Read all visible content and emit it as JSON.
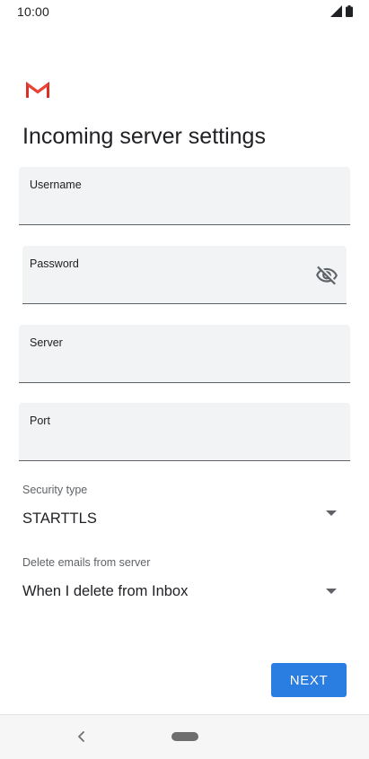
{
  "status_bar": {
    "time": "10:00",
    "icons": [
      "signal-icon",
      "battery-icon"
    ]
  },
  "app": {
    "logo": "gmail-logo"
  },
  "page": {
    "title": "Incoming server settings"
  },
  "fields": {
    "username": {
      "label": "Username",
      "value": ""
    },
    "password": {
      "label": "Password",
      "value": "",
      "toggle_icon": "visibility-off-icon"
    },
    "server": {
      "label": "Server",
      "value": ""
    },
    "port": {
      "label": "Port",
      "value": ""
    }
  },
  "security_type": {
    "label": "Security type",
    "value": "STARTTLS",
    "icon": "dropdown-arrow-icon"
  },
  "delete_emails": {
    "label": "Delete emails from server",
    "value": "When I delete from Inbox",
    "icon": "dropdown-arrow-icon"
  },
  "actions": {
    "next_label": "NEXT"
  },
  "colors": {
    "accent": "#2a7de1",
    "field_bg": "#f1f3f4",
    "text": "#202124",
    "secondary_text": "#5f6368"
  },
  "nav_bar": {
    "icons": [
      "back-icon",
      "home-pill-icon"
    ]
  }
}
